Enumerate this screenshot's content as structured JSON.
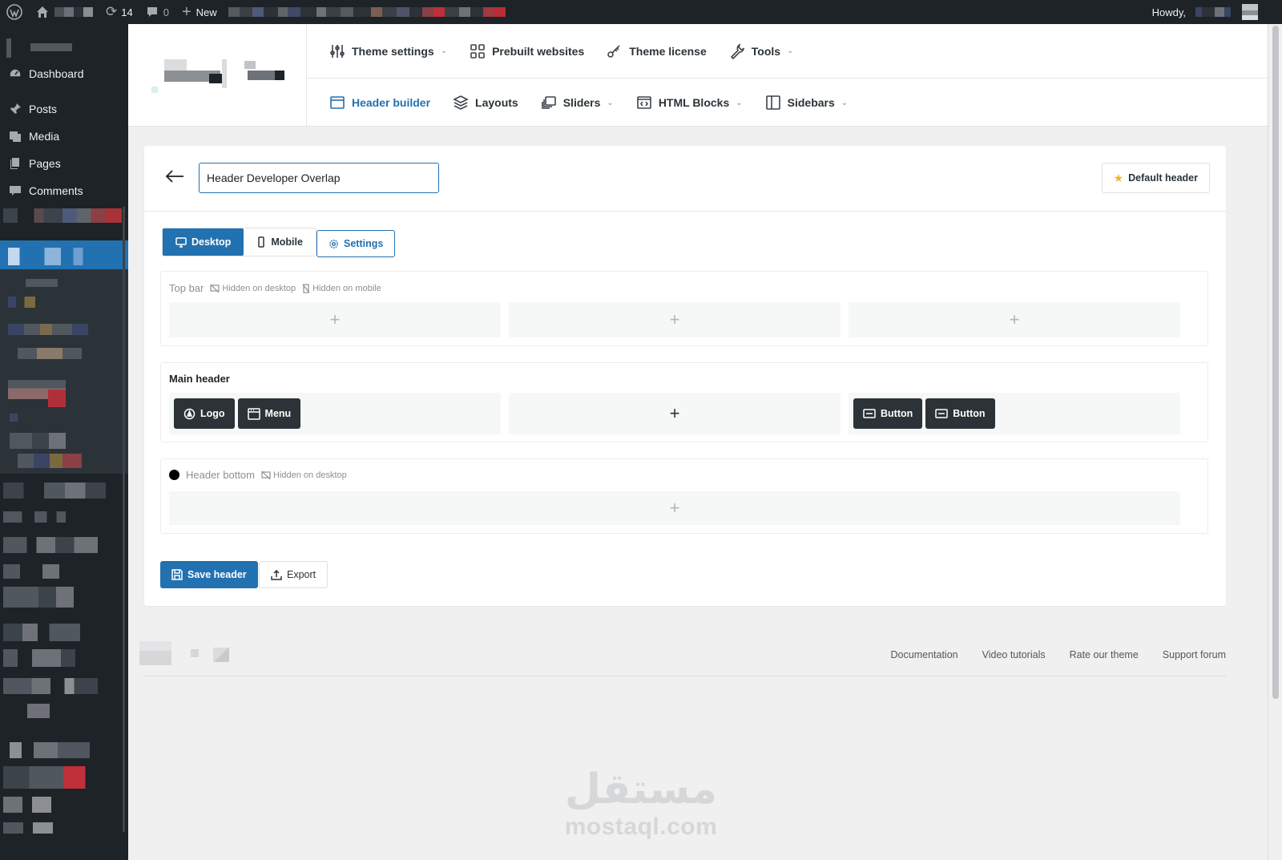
{
  "adminbar": {
    "updates_count": "14",
    "comments_count": "0",
    "new_label": "New",
    "howdy_label": "Howdy,",
    "icons": [
      "wordpress-logo-icon",
      "home-icon",
      "updates-icon",
      "comment-icon",
      "plus-icon"
    ]
  },
  "sidebar": {
    "items": [
      {
        "label": "Dashboard",
        "icon": "dashboard-icon"
      },
      {
        "label": "Posts",
        "icon": "pin-icon"
      },
      {
        "label": "Media",
        "icon": "media-icon"
      },
      {
        "label": "Pages",
        "icon": "pages-icon"
      },
      {
        "label": "Comments",
        "icon": "comment-icon"
      }
    ]
  },
  "theme_nav": {
    "row1": [
      {
        "label": "Theme settings",
        "icon": "sliders-icon",
        "dropdown": true
      },
      {
        "label": "Prebuilt websites",
        "icon": "grid-icon",
        "dropdown": false
      },
      {
        "label": "Theme license",
        "icon": "key-icon",
        "dropdown": false
      },
      {
        "label": "Tools",
        "icon": "wrench-icon",
        "dropdown": true
      }
    ],
    "row2": [
      {
        "label": "Header builder",
        "icon": "window-icon",
        "dropdown": false,
        "active": true
      },
      {
        "label": "Layouts",
        "icon": "layers-icon",
        "dropdown": false
      },
      {
        "label": "Sliders",
        "icon": "slides-icon",
        "dropdown": true
      },
      {
        "label": "HTML Blocks",
        "icon": "code-window-icon",
        "dropdown": true
      },
      {
        "label": "Sidebars",
        "icon": "sidebar-icon",
        "dropdown": true
      }
    ]
  },
  "editor": {
    "header_name": "Header Developer Overlap",
    "default_header_label": "Default header",
    "device_tabs": [
      {
        "label": "Desktop",
        "icon": "monitor-icon",
        "active": true
      },
      {
        "label": "Mobile",
        "icon": "phone-icon",
        "active": false
      }
    ],
    "settings_label": "Settings",
    "rows": {
      "top_bar": {
        "title": "Top bar",
        "tags": [
          "Hidden on desktop",
          "Hidden on mobile"
        ],
        "columns": [
          "+",
          "+",
          "+"
        ]
      },
      "main_header": {
        "title": "Main header",
        "left_elements": [
          {
            "label": "Logo",
            "icon": "logo-icon"
          },
          {
            "label": "Menu",
            "icon": "menu-icon"
          }
        ],
        "center": "+",
        "right_elements": [
          {
            "label": "Button",
            "icon": "button-icon"
          },
          {
            "label": "Button",
            "icon": "button-icon"
          }
        ]
      },
      "header_bottom": {
        "title": "Header bottom",
        "tags": [
          "Hidden on desktop"
        ],
        "columns": [
          "+"
        ]
      }
    },
    "save_label": "Save header",
    "export_label": "Export"
  },
  "footer": {
    "links": [
      "Documentation",
      "Video tutorials",
      "Rate our theme",
      "Support forum"
    ]
  },
  "watermark": {
    "arabic": "مستقل",
    "latin": "mostaql.com"
  },
  "colors": {
    "wp_dark": "#1d2327",
    "accent": "#2271b1",
    "element_dark": "#2c3338",
    "star": "#f0b429"
  }
}
